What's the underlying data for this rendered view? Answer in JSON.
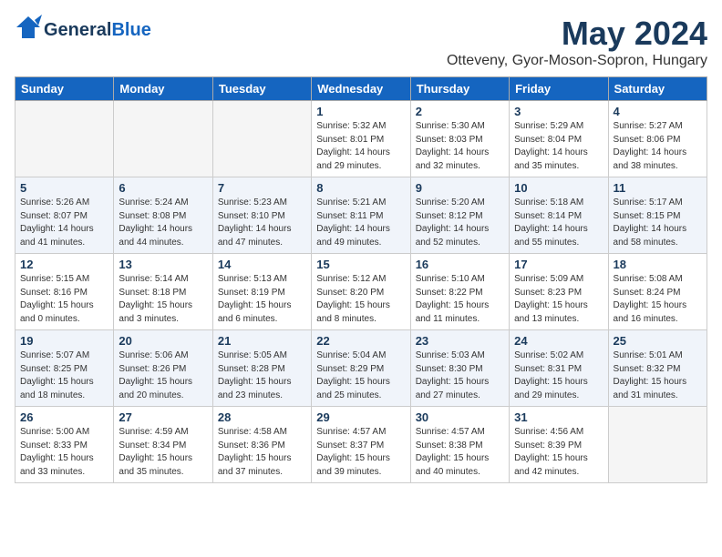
{
  "header": {
    "logo_general": "General",
    "logo_blue": "Blue",
    "month_title": "May 2024",
    "location": "Otteveny, Gyor-Moson-Sopron, Hungary"
  },
  "days_of_week": [
    "Sunday",
    "Monday",
    "Tuesday",
    "Wednesday",
    "Thursday",
    "Friday",
    "Saturday"
  ],
  "weeks": [
    [
      {
        "day": "",
        "info": ""
      },
      {
        "day": "",
        "info": ""
      },
      {
        "day": "",
        "info": ""
      },
      {
        "day": "1",
        "info": "Sunrise: 5:32 AM\nSunset: 8:01 PM\nDaylight: 14 hours\nand 29 minutes."
      },
      {
        "day": "2",
        "info": "Sunrise: 5:30 AM\nSunset: 8:03 PM\nDaylight: 14 hours\nand 32 minutes."
      },
      {
        "day": "3",
        "info": "Sunrise: 5:29 AM\nSunset: 8:04 PM\nDaylight: 14 hours\nand 35 minutes."
      },
      {
        "day": "4",
        "info": "Sunrise: 5:27 AM\nSunset: 8:06 PM\nDaylight: 14 hours\nand 38 minutes."
      }
    ],
    [
      {
        "day": "5",
        "info": "Sunrise: 5:26 AM\nSunset: 8:07 PM\nDaylight: 14 hours\nand 41 minutes."
      },
      {
        "day": "6",
        "info": "Sunrise: 5:24 AM\nSunset: 8:08 PM\nDaylight: 14 hours\nand 44 minutes."
      },
      {
        "day": "7",
        "info": "Sunrise: 5:23 AM\nSunset: 8:10 PM\nDaylight: 14 hours\nand 47 minutes."
      },
      {
        "day": "8",
        "info": "Sunrise: 5:21 AM\nSunset: 8:11 PM\nDaylight: 14 hours\nand 49 minutes."
      },
      {
        "day": "9",
        "info": "Sunrise: 5:20 AM\nSunset: 8:12 PM\nDaylight: 14 hours\nand 52 minutes."
      },
      {
        "day": "10",
        "info": "Sunrise: 5:18 AM\nSunset: 8:14 PM\nDaylight: 14 hours\nand 55 minutes."
      },
      {
        "day": "11",
        "info": "Sunrise: 5:17 AM\nSunset: 8:15 PM\nDaylight: 14 hours\nand 58 minutes."
      }
    ],
    [
      {
        "day": "12",
        "info": "Sunrise: 5:15 AM\nSunset: 8:16 PM\nDaylight: 15 hours\nand 0 minutes."
      },
      {
        "day": "13",
        "info": "Sunrise: 5:14 AM\nSunset: 8:18 PM\nDaylight: 15 hours\nand 3 minutes."
      },
      {
        "day": "14",
        "info": "Sunrise: 5:13 AM\nSunset: 8:19 PM\nDaylight: 15 hours\nand 6 minutes."
      },
      {
        "day": "15",
        "info": "Sunrise: 5:12 AM\nSunset: 8:20 PM\nDaylight: 15 hours\nand 8 minutes."
      },
      {
        "day": "16",
        "info": "Sunrise: 5:10 AM\nSunset: 8:22 PM\nDaylight: 15 hours\nand 11 minutes."
      },
      {
        "day": "17",
        "info": "Sunrise: 5:09 AM\nSunset: 8:23 PM\nDaylight: 15 hours\nand 13 minutes."
      },
      {
        "day": "18",
        "info": "Sunrise: 5:08 AM\nSunset: 8:24 PM\nDaylight: 15 hours\nand 16 minutes."
      }
    ],
    [
      {
        "day": "19",
        "info": "Sunrise: 5:07 AM\nSunset: 8:25 PM\nDaylight: 15 hours\nand 18 minutes."
      },
      {
        "day": "20",
        "info": "Sunrise: 5:06 AM\nSunset: 8:26 PM\nDaylight: 15 hours\nand 20 minutes."
      },
      {
        "day": "21",
        "info": "Sunrise: 5:05 AM\nSunset: 8:28 PM\nDaylight: 15 hours\nand 23 minutes."
      },
      {
        "day": "22",
        "info": "Sunrise: 5:04 AM\nSunset: 8:29 PM\nDaylight: 15 hours\nand 25 minutes."
      },
      {
        "day": "23",
        "info": "Sunrise: 5:03 AM\nSunset: 8:30 PM\nDaylight: 15 hours\nand 27 minutes."
      },
      {
        "day": "24",
        "info": "Sunrise: 5:02 AM\nSunset: 8:31 PM\nDaylight: 15 hours\nand 29 minutes."
      },
      {
        "day": "25",
        "info": "Sunrise: 5:01 AM\nSunset: 8:32 PM\nDaylight: 15 hours\nand 31 minutes."
      }
    ],
    [
      {
        "day": "26",
        "info": "Sunrise: 5:00 AM\nSunset: 8:33 PM\nDaylight: 15 hours\nand 33 minutes."
      },
      {
        "day": "27",
        "info": "Sunrise: 4:59 AM\nSunset: 8:34 PM\nDaylight: 15 hours\nand 35 minutes."
      },
      {
        "day": "28",
        "info": "Sunrise: 4:58 AM\nSunset: 8:36 PM\nDaylight: 15 hours\nand 37 minutes."
      },
      {
        "day": "29",
        "info": "Sunrise: 4:57 AM\nSunset: 8:37 PM\nDaylight: 15 hours\nand 39 minutes."
      },
      {
        "day": "30",
        "info": "Sunrise: 4:57 AM\nSunset: 8:38 PM\nDaylight: 15 hours\nand 40 minutes."
      },
      {
        "day": "31",
        "info": "Sunrise: 4:56 AM\nSunset: 8:39 PM\nDaylight: 15 hours\nand 42 minutes."
      },
      {
        "day": "",
        "info": ""
      }
    ]
  ]
}
